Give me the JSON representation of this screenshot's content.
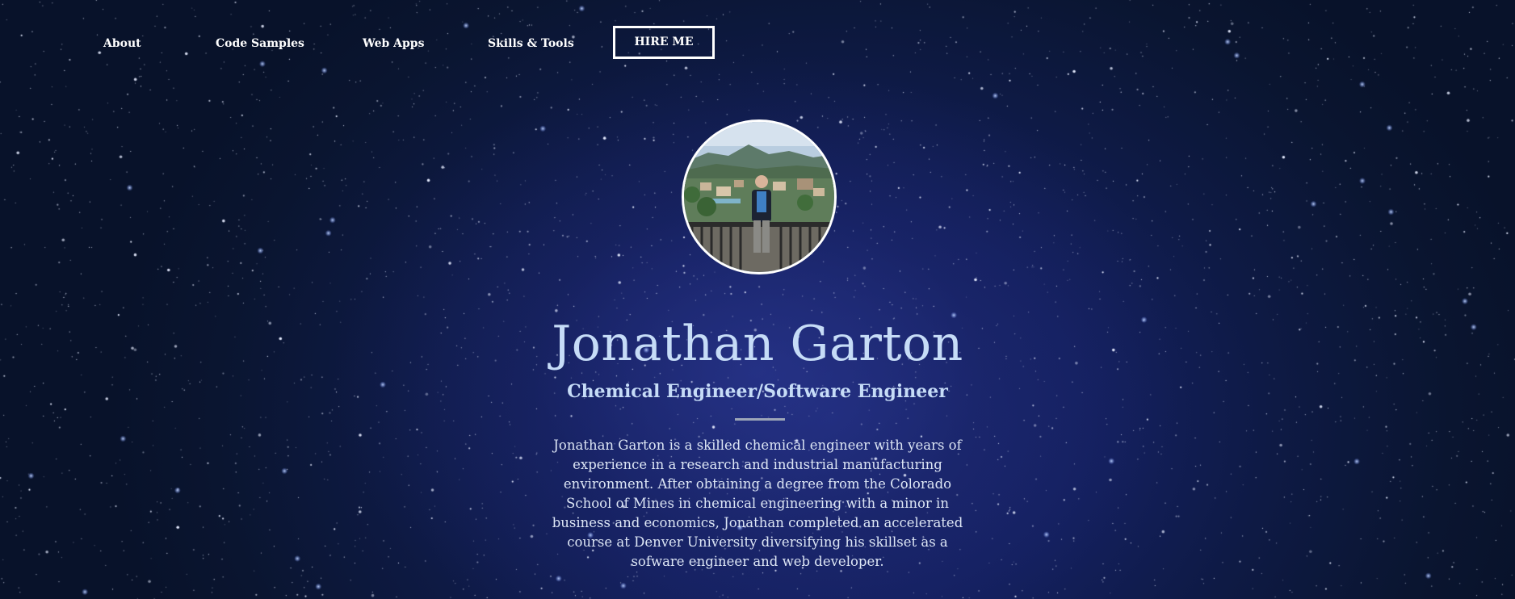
{
  "nav": {
    "items": [
      {
        "label": "About"
      },
      {
        "label": "Code Samples"
      },
      {
        "label": "Web Apps"
      },
      {
        "label": "Skills & Tools"
      }
    ],
    "cta_label": "HIRE ME"
  },
  "profile": {
    "avatar_icon": "profile-photo",
    "name": "Jonathan Garton",
    "title": "Chemical Engineer/Software Engineer",
    "bio": "Jonathan Garton is a skilled chemical engineer with years of experience in a research and industrial manufacturing environment. After obtaining a degree from the Colorado School of Mines in chemical engineering with a minor in business and economics, Jonathan completed an accelerated course at Denver University diversifying his skillset as a sofware engineer and web developer."
  },
  "colors": {
    "background": "#0b1430",
    "nebula": "#1d2a78",
    "heading_text": "#c6dcf7",
    "body_text": "#dde6f5",
    "nav_text": "#ffffff",
    "divider": "#9da6b8"
  }
}
